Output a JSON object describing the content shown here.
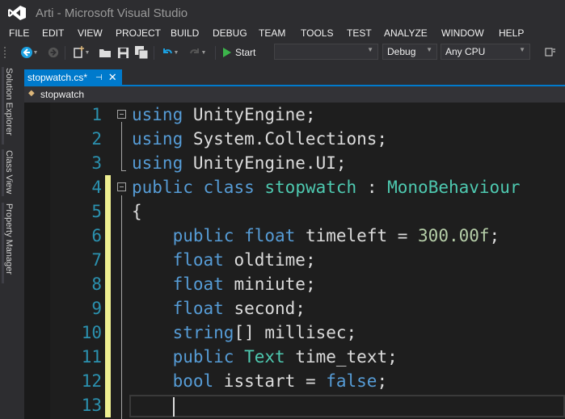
{
  "window": {
    "title": "Arti - Microsoft Visual Studio"
  },
  "menu": [
    "FILE",
    "EDIT",
    "VIEW",
    "PROJECT",
    "BUILD",
    "DEBUG",
    "TEAM",
    "TOOLS",
    "TEST",
    "ANALYZE",
    "WINDOW",
    "HELP"
  ],
  "toolbar": {
    "start_label": "Start",
    "target_value": "",
    "configuration": "Debug",
    "platform": "Any CPU"
  },
  "side_tabs": [
    "Solution Explorer",
    "Class View",
    "Property Manager"
  ],
  "document_tab": {
    "label": "stopwatch.cs*",
    "pin_glyph": "⊣",
    "close_glyph": "✕"
  },
  "navigation": {
    "class_label": "stopwatch"
  },
  "editor": {
    "line_numbers": [
      "1",
      "2",
      "3",
      "4",
      "5",
      "6",
      "7",
      "8",
      "9",
      "10",
      "11",
      "12",
      "13"
    ]
  },
  "colors": {
    "accent": "#007acc",
    "keyword": "#569cd6",
    "type": "#4ec9b0",
    "number": "#b5cea8",
    "line_number": "#2b91af",
    "changed_line": "#efef91"
  }
}
